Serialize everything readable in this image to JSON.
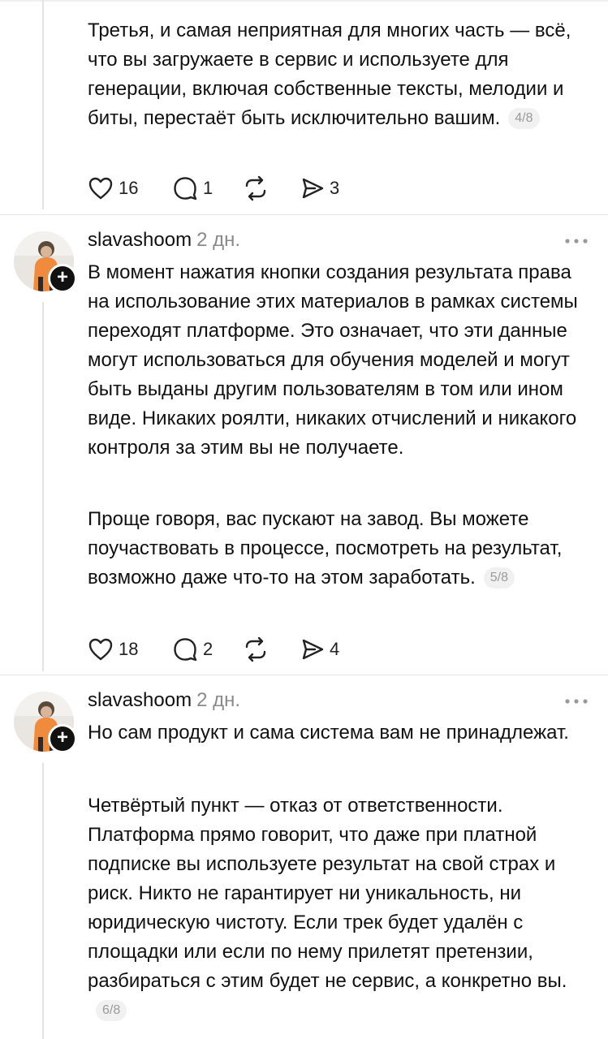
{
  "post_top": {
    "text": "Третья, и самая неприятная для многих часть — всё, что вы загружаете в сервис и используете для генерации, включая собственные тексты, мелодии и биты, перестаёт быть исключительно вашим.",
    "pager": "4/8",
    "likes": "16",
    "replies": "1",
    "reposts": "",
    "shares": "3"
  },
  "post_2": {
    "author": "slavashoom",
    "time": "2 дн.",
    "paragraph1": "В момент нажатия кнопки создания результата права на использование этих материалов в рамках системы переходят платформе. Это означает, что эти данные могут использоваться для обучения моделей и могут быть выданы другим пользователям в том или ином виде. Никаких роялти, никаких отчислений и никакого контроля за этим вы не получаете.",
    "paragraph2": "Проще говоря, вас пускают на завод. Вы можете поучаствовать в процессе, посмотреть на результат, возможно даже что-то на этом заработать.",
    "pager": "5/8",
    "likes": "18",
    "replies": "2",
    "shares": "4"
  },
  "post_3": {
    "author": "slavashoom",
    "time": "2 дн.",
    "paragraph1": "Но сам продукт и сама система вам не принадлежат.",
    "paragraph2": "Четвёртый пункт — отказ от ответственности. Платформа прямо говорит, что даже при платной подписке вы используете результат на свой страх и риск. Никто не гарантирует ни уникальность, ни юридическую чистоту. Если трек будет удалён с площадки или если по нему прилетят претензии, разбираться с этим будет не сервис, а конкретно вы.",
    "pager": "6/8"
  },
  "icons": {
    "like": "heart-icon",
    "reply": "comment-icon",
    "repost": "repost-icon",
    "share": "send-icon",
    "more": "more-dots-icon",
    "follow": "plus-icon"
  }
}
